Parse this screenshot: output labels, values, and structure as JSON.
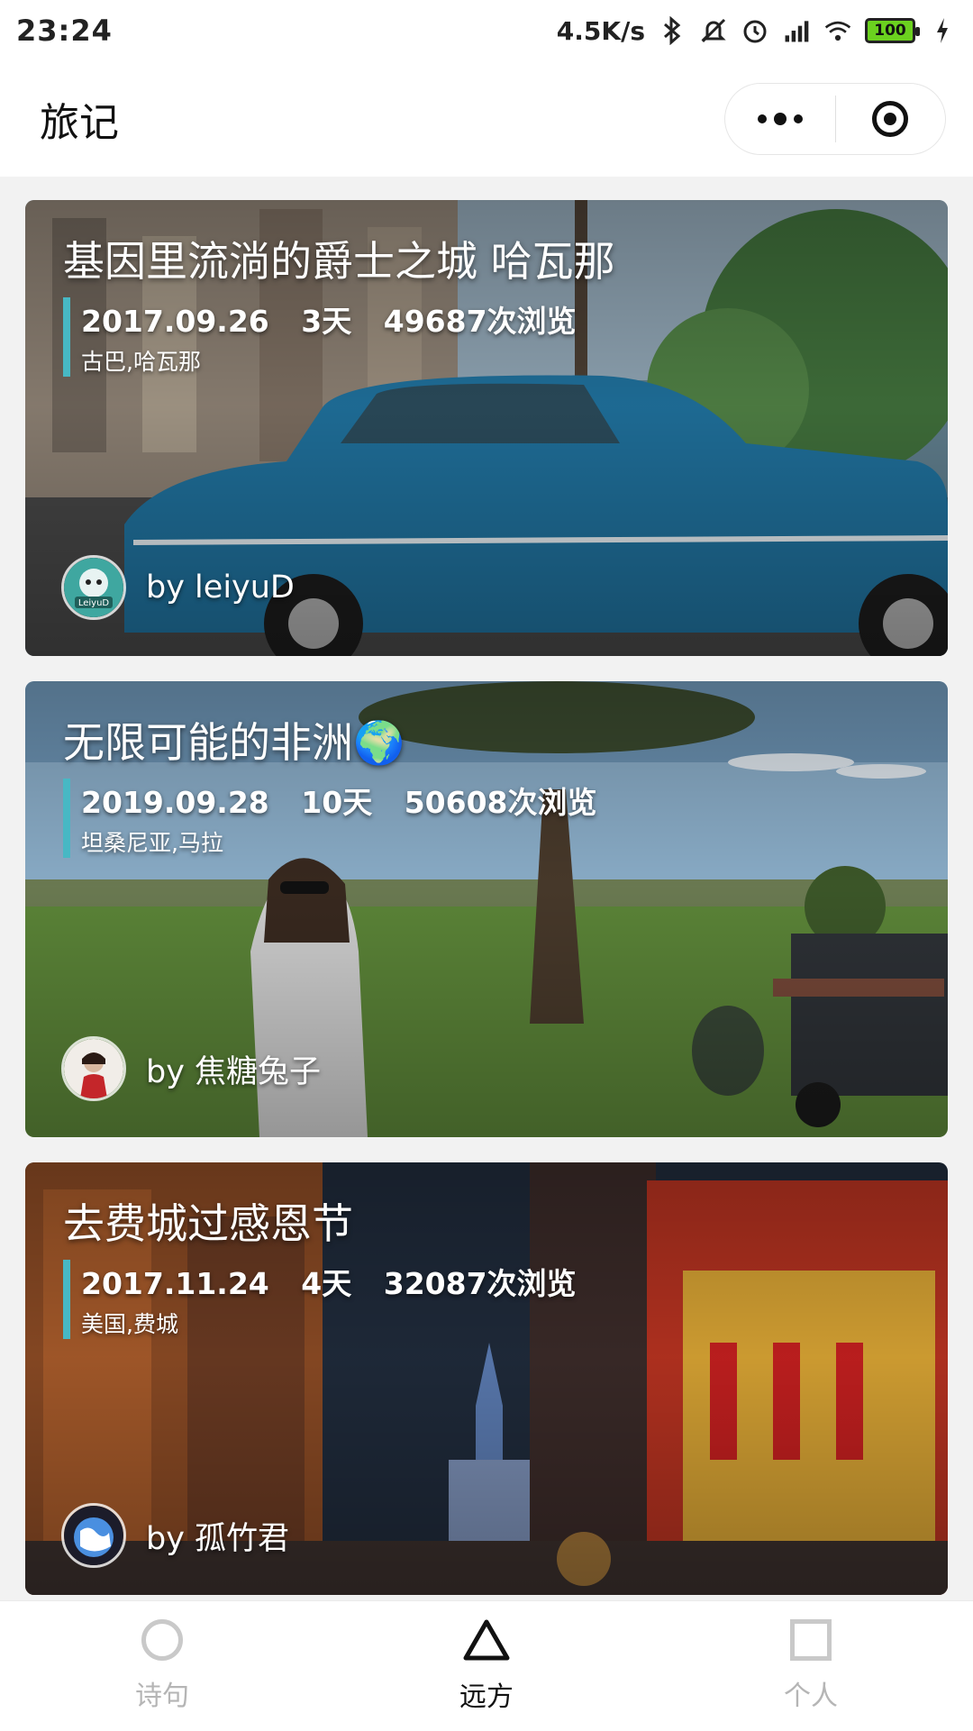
{
  "status_bar": {
    "time": "23:24",
    "net_speed": "4.5K/s",
    "battery": "100",
    "icons": [
      "bluetooth-icon",
      "mute-icon",
      "alarm-icon",
      "signal-icon",
      "wifi-icon",
      "battery-icon",
      "charging-icon"
    ]
  },
  "header": {
    "title": "旅记"
  },
  "cards": [
    {
      "title": "基因里流淌的爵士之城 哈瓦那",
      "date": "2017.09.26",
      "days": "3天",
      "views": "49687次浏览",
      "location": "古巴,哈瓦那",
      "author": "by leiyuD",
      "avatar_text": "LeiyuD"
    },
    {
      "title": "无限可能的非洲🌍",
      "date": "2019.09.28",
      "days": "10天",
      "views": "50608次浏览",
      "location": "坦桑尼亚,马拉",
      "author": "by 焦糖兔子"
    },
    {
      "title": "去费城过感恩节",
      "date": "2017.11.24",
      "days": "4天",
      "views": "32087次浏览",
      "location": "美国,费城",
      "author": "by 孤竹君"
    }
  ],
  "tabs": [
    {
      "label": "诗句",
      "icon": "circle-icon",
      "active": false
    },
    {
      "label": "远方",
      "icon": "triangle-icon",
      "active": true
    },
    {
      "label": "个人",
      "icon": "square-icon",
      "active": false
    }
  ],
  "colors": {
    "accent_bar": "#47b8c4",
    "active_tab": "#111111",
    "inactive_tab": "#b5b5b5"
  }
}
